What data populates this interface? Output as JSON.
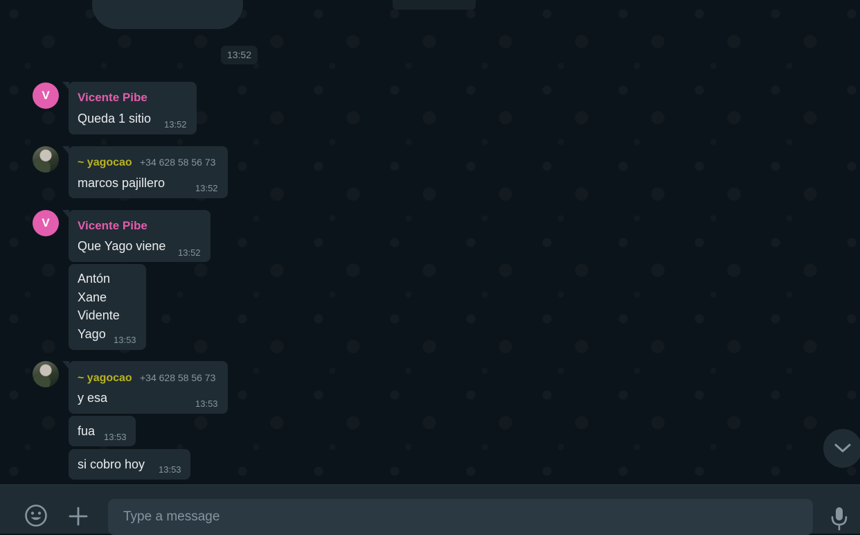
{
  "divider_time": "13:52",
  "messages": [
    {
      "sender": "Vicente Pibe",
      "avatar_letter": "V",
      "text": "Queda 1 sitio",
      "time": "13:52"
    },
    {
      "sender": "~ yagocao",
      "phone": "+34 628 58 56 73",
      "text": "marcos pajillero",
      "time": "13:52"
    },
    {
      "sender": "Vicente Pibe",
      "avatar_letter": "V",
      "text": "Que Yago viene",
      "time": "13:52"
    },
    {
      "text": "Antón\nXane\nVidente\nYago",
      "time": "13:53"
    },
    {
      "sender": "~ yagocao",
      "phone": "+34 628 58 56 73",
      "text": "y esa",
      "time": "13:53"
    },
    {
      "text": "fua",
      "time": "13:53"
    },
    {
      "text": "si cobro hoy",
      "time": "13:53"
    }
  ],
  "compose": {
    "placeholder": "Type a message",
    "icons": [
      "emoji-icon",
      "plus-icon",
      "microphone-icon"
    ]
  },
  "icons": {
    "scroll_down": "chevron-down-icon"
  },
  "colors": {
    "background": "#0b141a",
    "bubble": "#202c33",
    "sender_pink": "#e35eae",
    "sender_yellow": "#b8b31f",
    "timestamp": "#8696a0"
  }
}
